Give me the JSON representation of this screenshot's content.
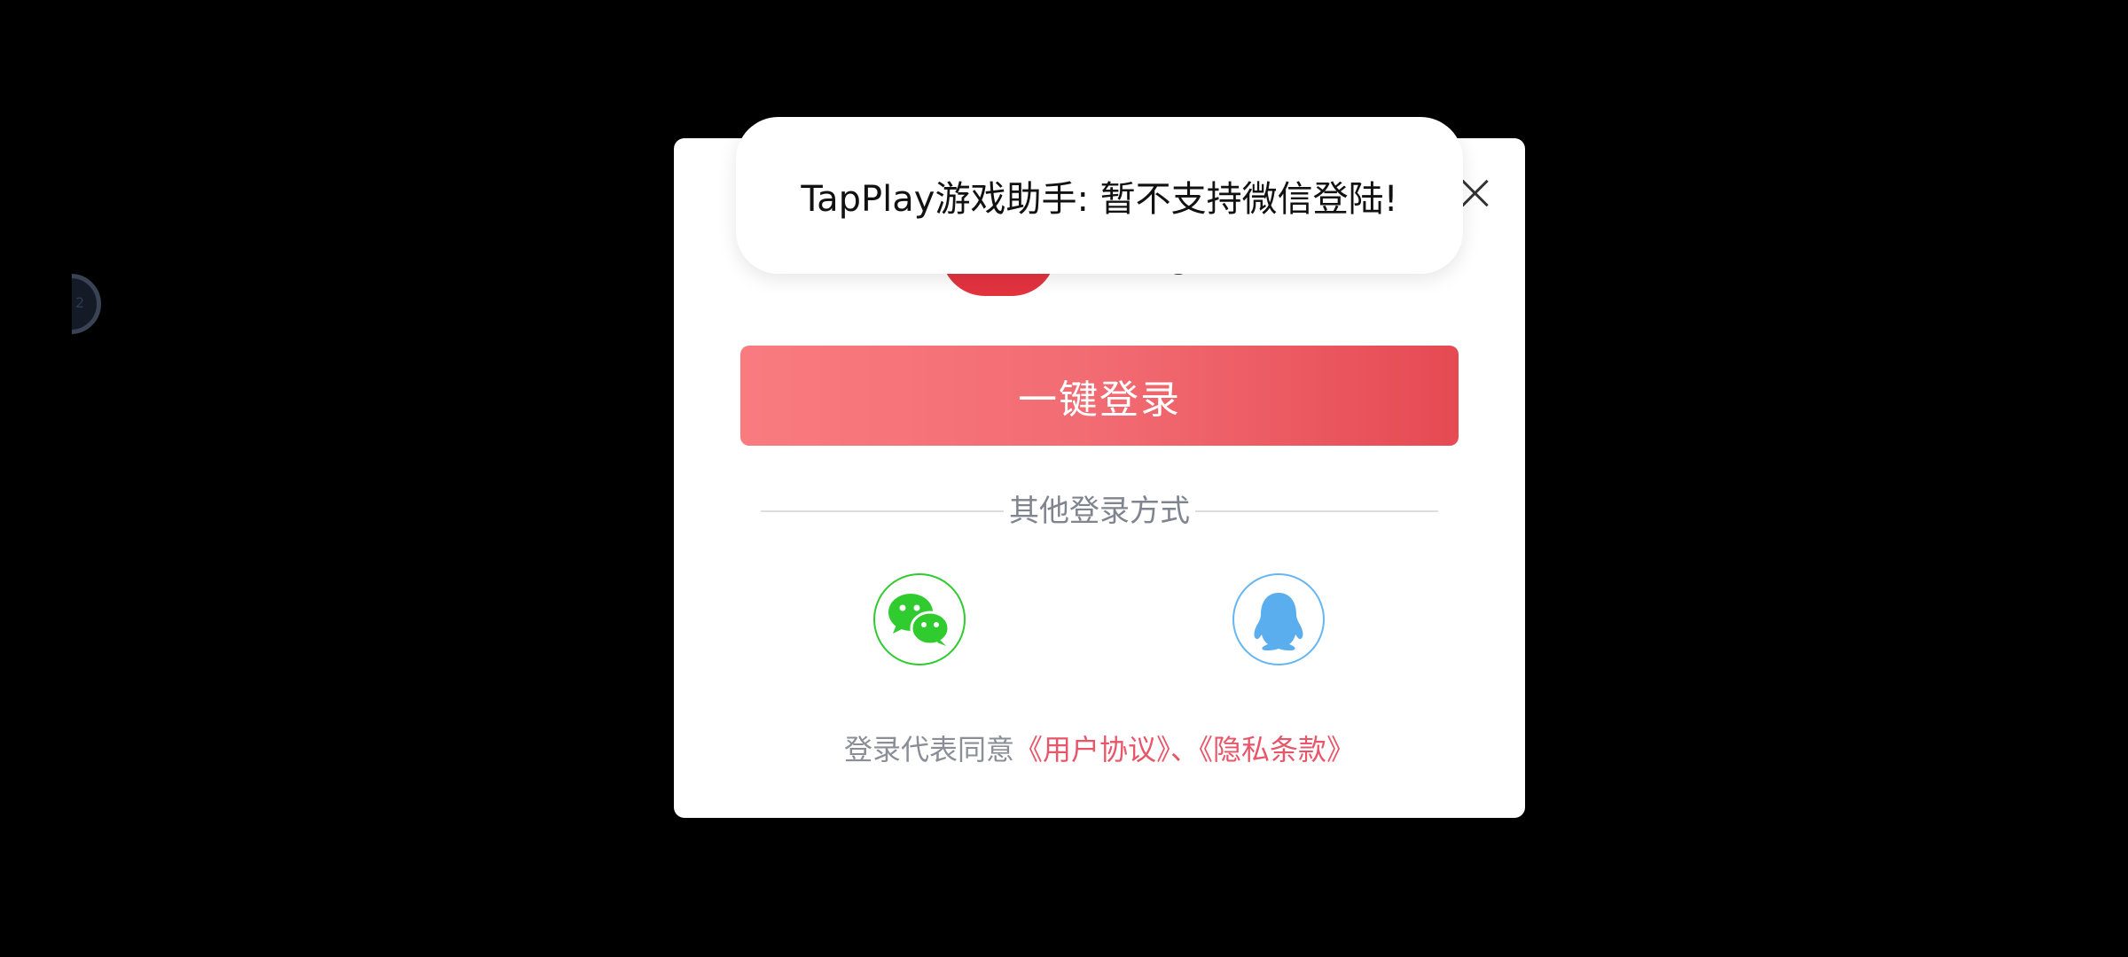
{
  "float_ball": {
    "text": "2"
  },
  "dialog": {
    "close_icon": "close-icon",
    "primary_button": "一键登录",
    "divider_label": "其他登录方式",
    "social": [
      {
        "name": "wechat",
        "icon": "wechat-icon",
        "color": "#2fcb2f"
      },
      {
        "name": "qq",
        "icon": "qq-penguin-icon",
        "color": "#66b6f2"
      }
    ],
    "agreement": {
      "prefix": "登录代表同意",
      "user_agreement": "《用户协议》",
      "separator": "、",
      "privacy_policy": "《隐私条款》"
    }
  },
  "toast": {
    "message": "TapPlay游戏助手: 暂不支持微信登陆!"
  },
  "colors": {
    "primary": "#f26b72",
    "link": "#e8566a",
    "background": "#000000"
  }
}
